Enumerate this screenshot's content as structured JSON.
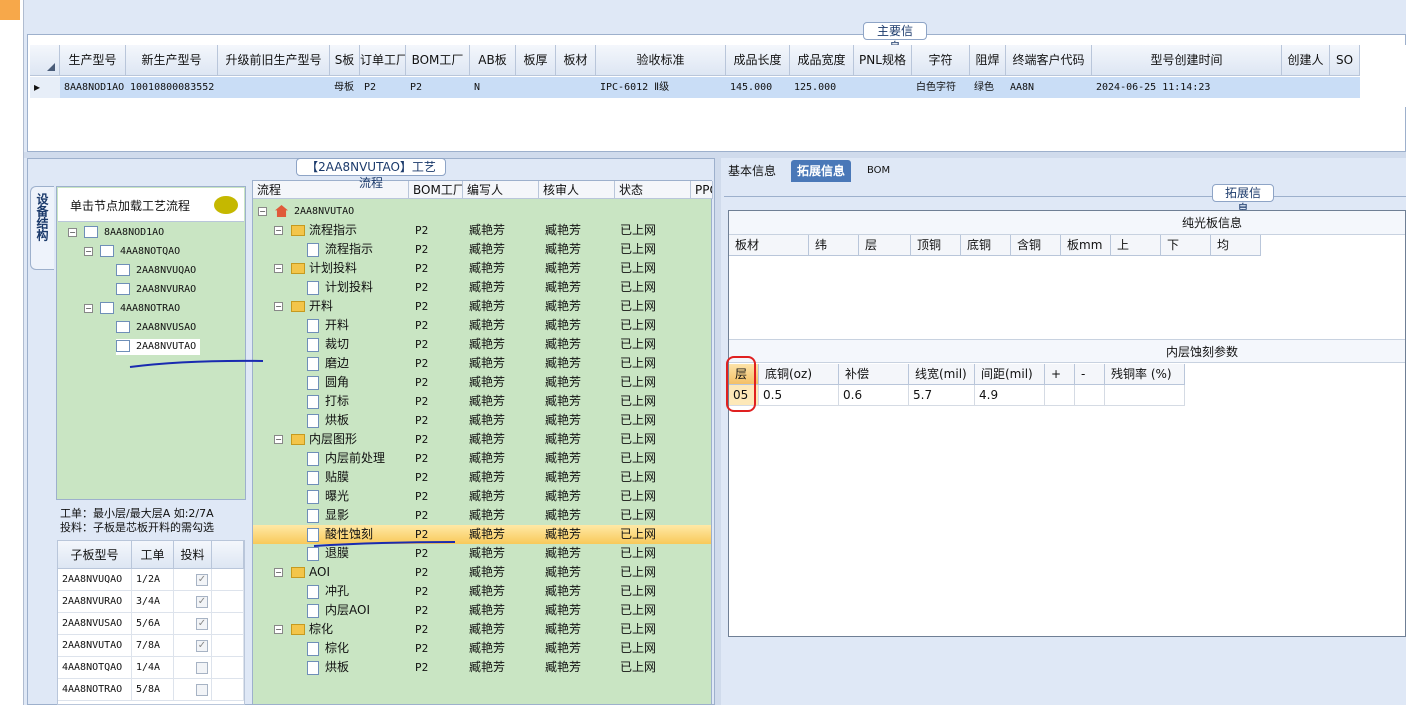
{
  "main_info": {
    "title": "主要信息",
    "columns": [
      "生产型号",
      "新生产型号",
      "升级前旧生产型号",
      "S板",
      "订单工厂",
      "BOM工厂",
      "AB板",
      "板厚",
      "板材",
      "验收标准",
      "成品长度",
      "成品宽度",
      "PNL规格",
      "字符",
      "阻焊",
      "终端客户代码",
      "型号创建时间",
      "创建人",
      "SO"
    ],
    "row": [
      "8AA8NOD1AO",
      "10010800083552",
      "",
      "母板",
      "P2",
      "P2",
      "N",
      "",
      "",
      "IPC-6012 Ⅱ级",
      "145.000",
      "125.000",
      "",
      "白色字符",
      "绿色",
      "AA8N",
      "2024-06-25 11:14:23",
      "",
      ""
    ]
  },
  "left_tab": "设备结构",
  "tree": {
    "header": "单击节点加载工艺流程",
    "nodes": [
      {
        "label": "8AA8NOD1AO",
        "level": 0
      },
      {
        "label": "4AA8NOTQAO",
        "level": 1
      },
      {
        "label": "2AA8NVUQAO",
        "level": 2
      },
      {
        "label": "2AA8NVURAO",
        "level": 2
      },
      {
        "label": "4AA8NOTRAO",
        "level": 1
      },
      {
        "label": "2AA8NVUSAO",
        "level": 2
      },
      {
        "label": "2AA8NVUTAO",
        "level": 2
      }
    ]
  },
  "hint": {
    "line1": "工单：最小层/最大层A 如:2/7A",
    "line2": "投料：子板是芯板开料的需勾选"
  },
  "sub_grid": {
    "columns": [
      "子板型号",
      "工单",
      "投料"
    ],
    "rows": [
      {
        "model": "2AA8NVUQAO",
        "order": "1/2A",
        "feed": true
      },
      {
        "model": "2AA8NVURAO",
        "order": "3/4A",
        "feed": true
      },
      {
        "model": "2AA8NVUSAO",
        "order": "5/6A",
        "feed": true
      },
      {
        "model": "2AA8NVUTAO",
        "order": "7/8A",
        "feed": true
      },
      {
        "model": "4AA8NOTQAO",
        "order": "1/4A",
        "feed": false
      },
      {
        "model": "4AA8NOTRAO",
        "order": "5/8A",
        "feed": false
      }
    ]
  },
  "flow": {
    "title": "【2AA8NVUTAO】工艺流程",
    "columns": [
      "流程",
      "BOM工厂",
      "编写人",
      "核审人",
      "状态",
      "PPO"
    ],
    "root": "2AA8NVUTAO",
    "rows": [
      {
        "label": "流程指示",
        "type": "folder",
        "bom": "P2",
        "writer": "臧艳芳",
        "reviewer": "臧艳芳",
        "status": "已上网"
      },
      {
        "label": "流程指示",
        "type": "doc",
        "bom": "P2",
        "writer": "臧艳芳",
        "reviewer": "臧艳芳",
        "status": "已上网"
      },
      {
        "label": "计划投料",
        "type": "folder",
        "bom": "P2",
        "writer": "臧艳芳",
        "reviewer": "臧艳芳",
        "status": "已上网"
      },
      {
        "label": "计划投料",
        "type": "doc",
        "bom": "P2",
        "writer": "臧艳芳",
        "reviewer": "臧艳芳",
        "status": "已上网"
      },
      {
        "label": "开料",
        "type": "folder",
        "bom": "P2",
        "writer": "臧艳芳",
        "reviewer": "臧艳芳",
        "status": "已上网"
      },
      {
        "label": "开料",
        "type": "doc",
        "bom": "P2",
        "writer": "臧艳芳",
        "reviewer": "臧艳芳",
        "status": "已上网"
      },
      {
        "label": "裁切",
        "type": "doc",
        "bom": "P2",
        "writer": "臧艳芳",
        "reviewer": "臧艳芳",
        "status": "已上网"
      },
      {
        "label": "磨边",
        "type": "doc",
        "bom": "P2",
        "writer": "臧艳芳",
        "reviewer": "臧艳芳",
        "status": "已上网"
      },
      {
        "label": "圆角",
        "type": "doc",
        "bom": "P2",
        "writer": "臧艳芳",
        "reviewer": "臧艳芳",
        "status": "已上网"
      },
      {
        "label": "打标",
        "type": "doc",
        "bom": "P2",
        "writer": "臧艳芳",
        "reviewer": "臧艳芳",
        "status": "已上网"
      },
      {
        "label": "烘板",
        "type": "doc",
        "bom": "P2",
        "writer": "臧艳芳",
        "reviewer": "臧艳芳",
        "status": "已上网"
      },
      {
        "label": "内层图形",
        "type": "folder",
        "bom": "P2",
        "writer": "臧艳芳",
        "reviewer": "臧艳芳",
        "status": "已上网"
      },
      {
        "label": "内层前处理",
        "type": "doc",
        "bom": "P2",
        "writer": "臧艳芳",
        "reviewer": "臧艳芳",
        "status": "已上网"
      },
      {
        "label": "贴膜",
        "type": "doc",
        "bom": "P2",
        "writer": "臧艳芳",
        "reviewer": "臧艳芳",
        "status": "已上网"
      },
      {
        "label": "曝光",
        "type": "doc",
        "bom": "P2",
        "writer": "臧艳芳",
        "reviewer": "臧艳芳",
        "status": "已上网"
      },
      {
        "label": "显影",
        "type": "doc",
        "bom": "P2",
        "writer": "臧艳芳",
        "reviewer": "臧艳芳",
        "status": "已上网"
      },
      {
        "label": "酸性蚀刻",
        "type": "doc",
        "bom": "P2",
        "writer": "臧艳芳",
        "reviewer": "臧艳芳",
        "status": "已上网",
        "selected": true
      },
      {
        "label": "退膜",
        "type": "doc",
        "bom": "P2",
        "writer": "臧艳芳",
        "reviewer": "臧艳芳",
        "status": "已上网"
      },
      {
        "label": "AOI",
        "type": "folder",
        "bom": "P2",
        "writer": "臧艳芳",
        "reviewer": "臧艳芳",
        "status": "已上网"
      },
      {
        "label": "冲孔",
        "type": "doc",
        "bom": "P2",
        "writer": "臧艳芳",
        "reviewer": "臧艳芳",
        "status": "已上网"
      },
      {
        "label": "内层AOI",
        "type": "doc",
        "bom": "P2",
        "writer": "臧艳芳",
        "reviewer": "臧艳芳",
        "status": "已上网"
      },
      {
        "label": "棕化",
        "type": "folder",
        "bom": "P2",
        "writer": "臧艳芳",
        "reviewer": "臧艳芳",
        "status": "已上网"
      },
      {
        "label": "棕化",
        "type": "doc",
        "bom": "P2",
        "writer": "臧艳芳",
        "reviewer": "臧艳芳",
        "status": "已上网"
      },
      {
        "label": "烘板",
        "type": "doc",
        "bom": "P2",
        "writer": "臧艳芳",
        "reviewer": "臧艳芳",
        "status": "已上网"
      }
    ]
  },
  "right_tabs": [
    "基本信息",
    "拓展信息",
    "BOM"
  ],
  "ext": {
    "title": "拓展信息",
    "section1": {
      "title": "纯光板信息",
      "columns": [
        "板材",
        "纬",
        "层",
        "顶铜",
        "底铜",
        "含铜",
        "板mm",
        "上",
        "下",
        "均"
      ]
    },
    "section2": {
      "title": "内层蚀刻参数",
      "columns": [
        "层",
        "底铜(oz)",
        "补偿",
        "线宽(mil)",
        "间距(mil)",
        "+",
        "-",
        "残铜率 (%)"
      ],
      "row": [
        "05",
        "0.5",
        "0.6",
        "5.7",
        "4.9",
        "",
        "",
        ""
      ]
    }
  },
  "colors": {
    "selection": "#c9ddf6",
    "tree_bg": "#c9e5c3",
    "highlight": "#f8c95a",
    "accent": "#4a78b8",
    "annotation_red": "#e02020",
    "annotation_ink": "#1a2bb0"
  }
}
